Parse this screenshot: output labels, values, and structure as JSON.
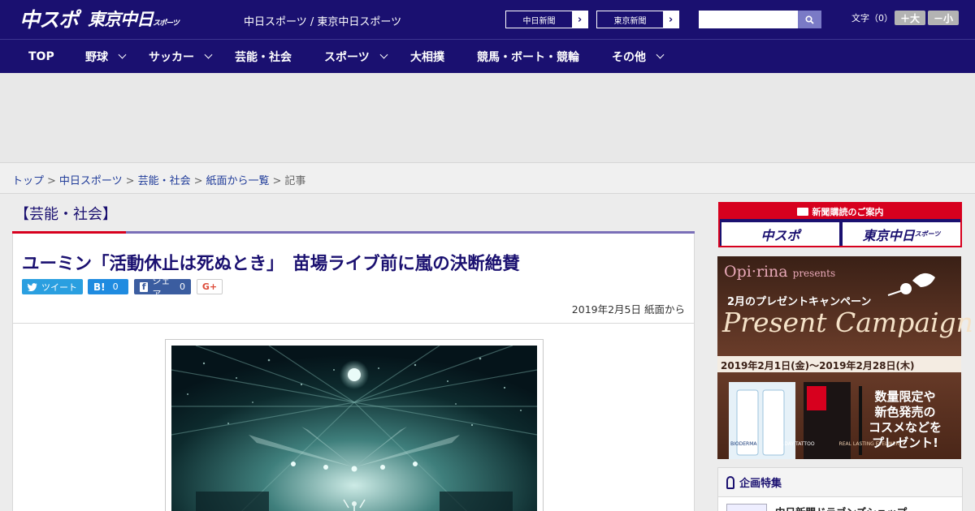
{
  "header": {
    "logo_main": "中スポ",
    "logo_tokyo": "東京中日",
    "logo_tokyo_sub": "スポーツ",
    "site_links": "中日スポーツ / 東京中日スポーツ",
    "paper_buttons": [
      "中日新聞",
      "東京新聞"
    ],
    "search_placeholder": "",
    "search_icon": "search-icon",
    "font_size_label": "文字（0）",
    "font_larger": "＋大",
    "font_smaller": "－小"
  },
  "nav": [
    {
      "label": "TOP",
      "has_menu": false
    },
    {
      "label": "野球",
      "has_menu": true
    },
    {
      "label": "サッカー",
      "has_menu": true
    },
    {
      "label": "芸能・社会",
      "has_menu": false
    },
    {
      "label": "スポーツ",
      "has_menu": true
    },
    {
      "label": "大相撲",
      "has_menu": false
    },
    {
      "label": "競馬・ボート・競輪",
      "has_menu": false
    },
    {
      "label": "その他",
      "has_menu": true
    }
  ],
  "breadcrumb": {
    "links": [
      "トップ",
      "中日スポーツ",
      "芸能・社会",
      "紙面から一覧"
    ],
    "current": "記事",
    "separator": ">"
  },
  "article": {
    "category": "【芸能・社会】",
    "headline": "ユーミン「活動休止は死ぬとき」　苗場ライブ前に嵐の決断絶賛",
    "share": {
      "tweet": "ツイート",
      "hatena_label": "B!",
      "hatena_count": "0",
      "facebook": "シェア",
      "facebook_count": "0",
      "gplus": "G+"
    },
    "dateline": "2019年2月5日 紙面から",
    "photo_icon": "concert-stage-photo"
  },
  "sidebar": {
    "subscribe_header": "新聞購読のご案内",
    "subscribe_buttons": [
      "中スポ",
      "東京中日"
    ],
    "subscribe_tokyo_sub": "スポーツ",
    "campaign": {
      "brand": "Opi·rina",
      "brand_suffix": "presents",
      "subtitle": "2月のプレゼントキャンペーン",
      "title": "Present Campaign",
      "period": "2019年2月1日(金)〜2019年2月28日(木)",
      "tagline": [
        "数量限定や",
        "新色発売の",
        "コスメなどを",
        "プレゼント!"
      ],
      "products": [
        "BIODERMA",
        "1DAY TATTOO",
        "REAL LASTING EYELINER"
      ]
    },
    "feature_header": "企画特集",
    "feature_item": "中日新聞ドラゴンズショップ"
  },
  "colors": {
    "navy": "#1a1070",
    "red": "#d7001e",
    "link": "#1f3b99"
  }
}
